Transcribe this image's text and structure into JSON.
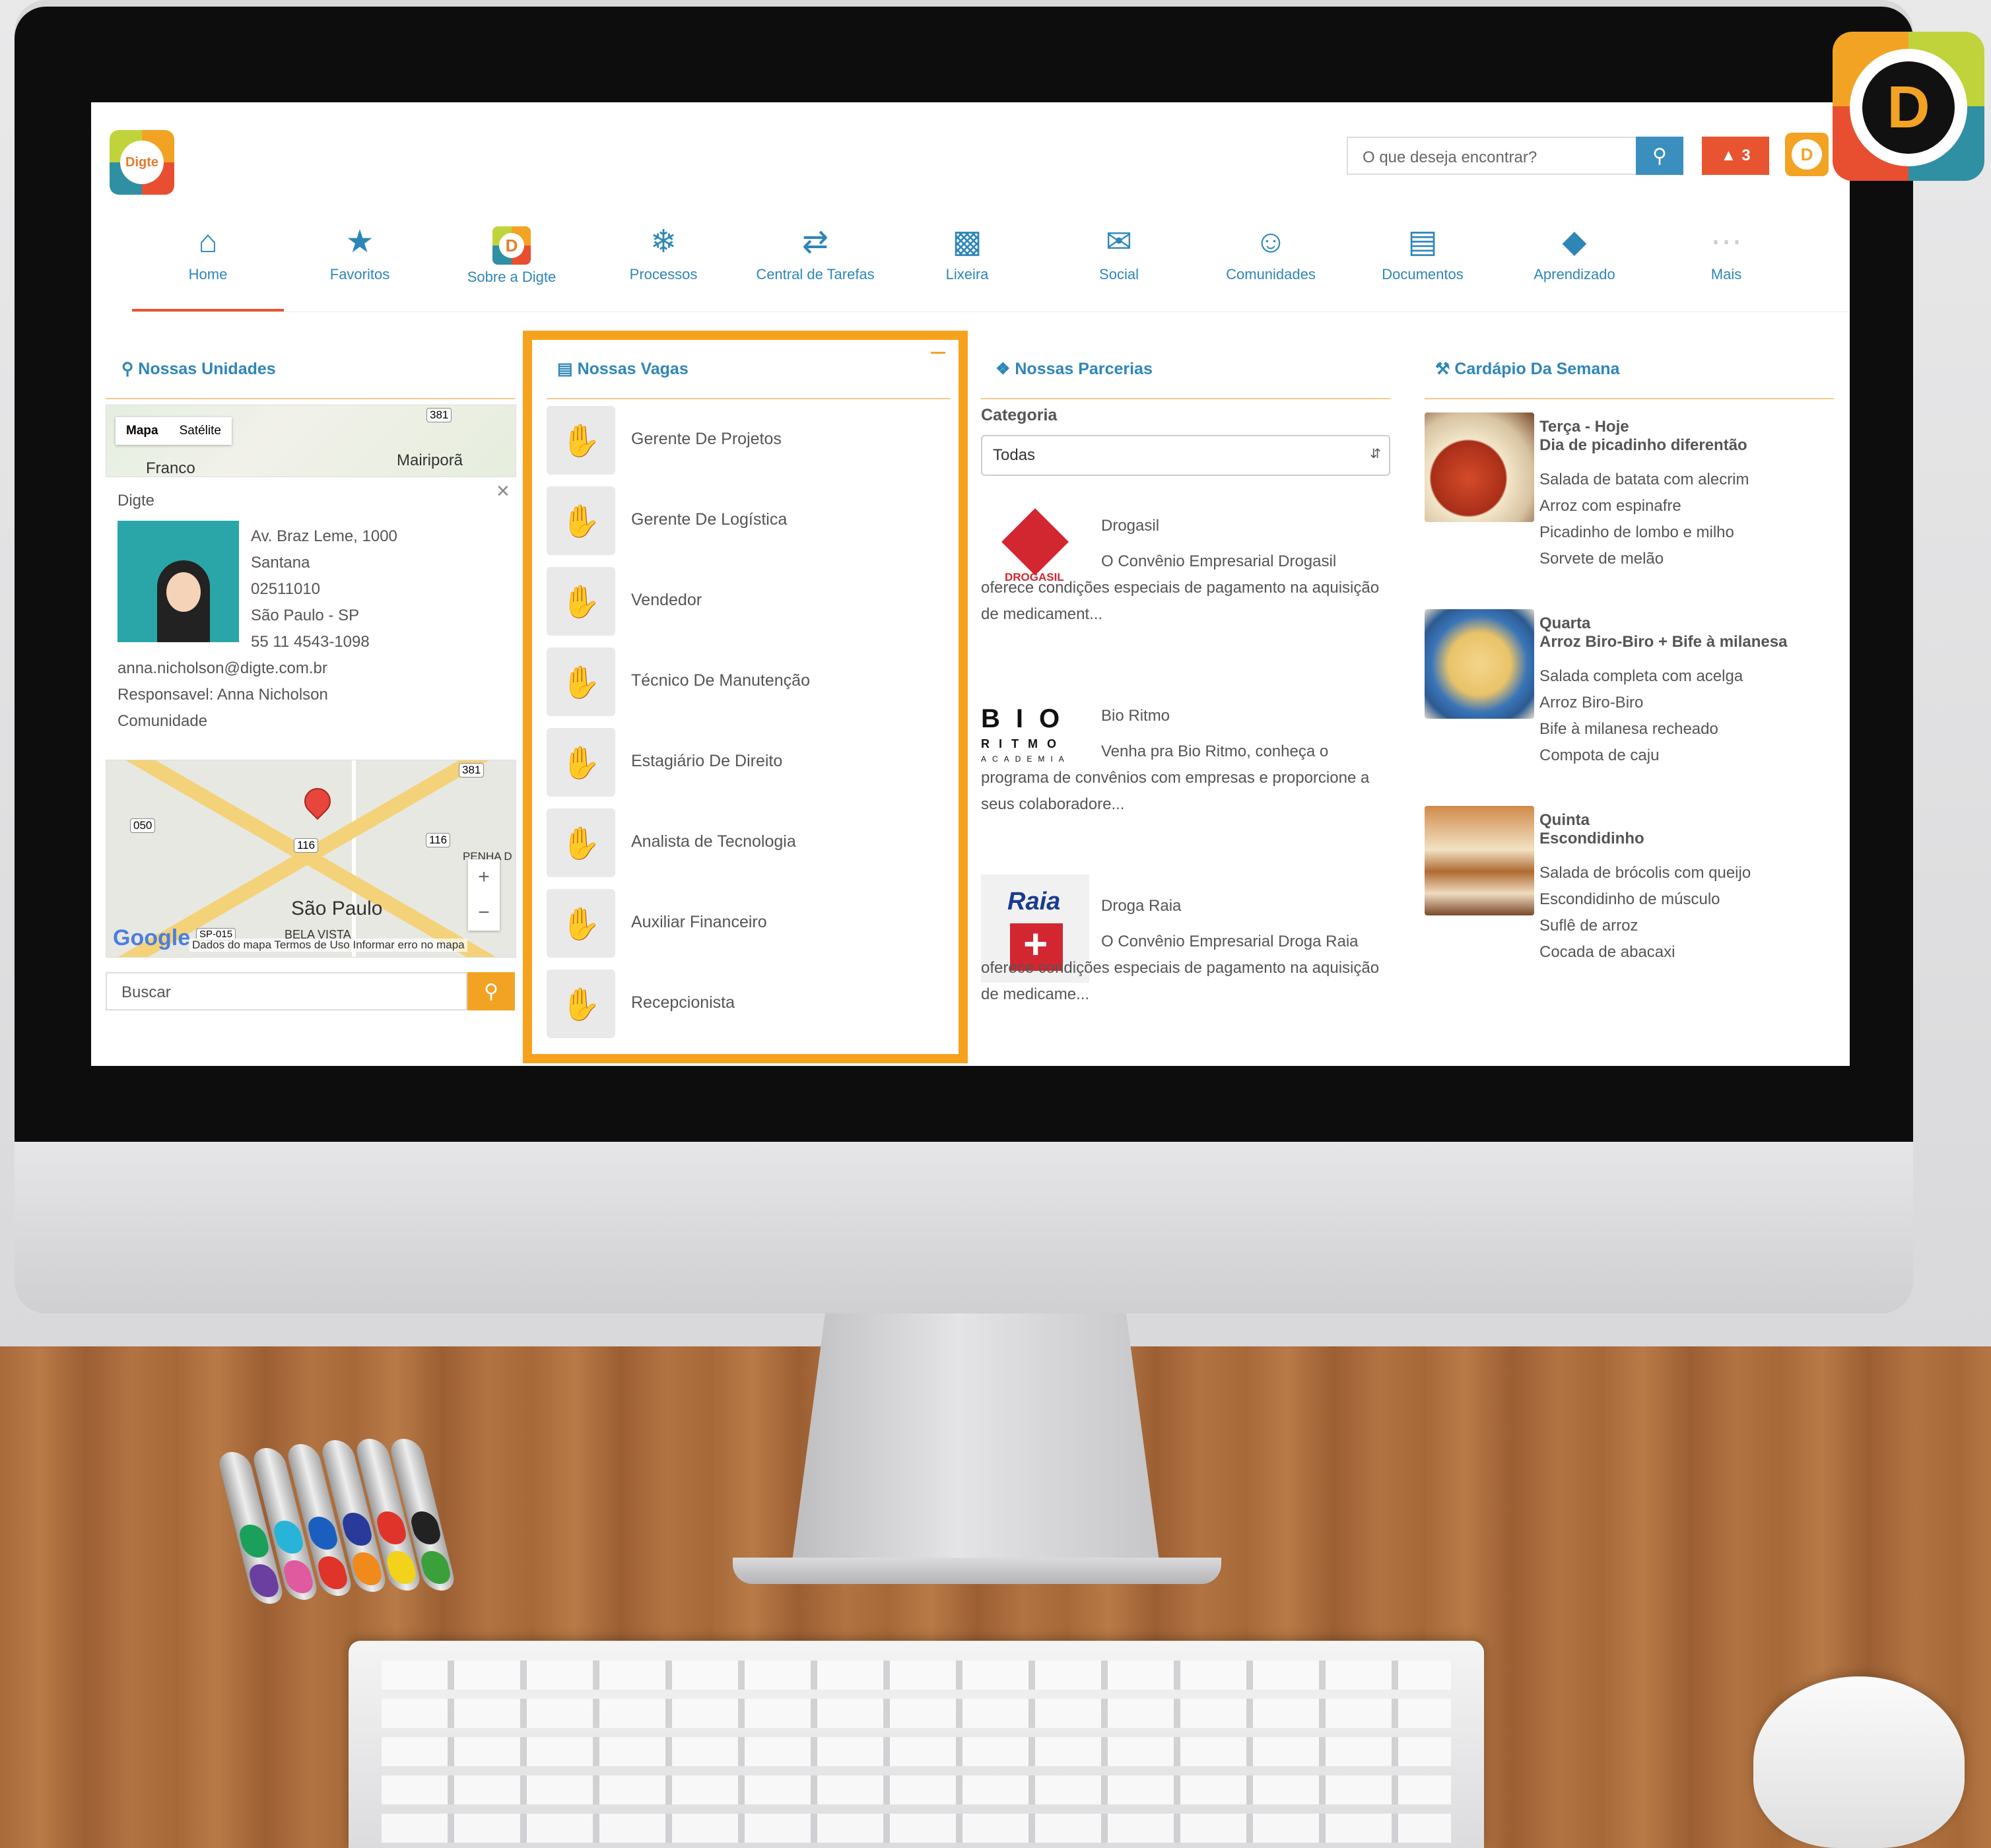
{
  "header": {
    "logo_text": "Digte",
    "search_placeholder": "O que deseja encontrar?",
    "alerts_count": "3",
    "avatar_letter": "D"
  },
  "nav": [
    {
      "label": "Home",
      "icon": "home-icon",
      "active": true
    },
    {
      "label": "Favoritos",
      "icon": "star-icon"
    },
    {
      "label": "Sobre a Digte",
      "icon": "digte-logo-icon"
    },
    {
      "label": "Processos",
      "icon": "processes-icon"
    },
    {
      "label": "Central de Tarefas",
      "icon": "tasks-icon"
    },
    {
      "label": "Lixeira",
      "icon": "trash-icon"
    },
    {
      "label": "Social",
      "icon": "chat-icon"
    },
    {
      "label": "Comunidades",
      "icon": "communities-icon"
    },
    {
      "label": "Documentos",
      "icon": "documents-icon"
    },
    {
      "label": "Aprendizado",
      "icon": "graduation-cap-icon"
    },
    {
      "label": "Mais",
      "icon": "more-icon"
    }
  ],
  "unidades": {
    "title": "Nossas Unidades",
    "map_tab_map": "Mapa",
    "map_tab_sat": "Satélite",
    "map_label_1": "Franco",
    "map_label_2": "Mairiporã",
    "road_381": "381",
    "name": "Digte",
    "address_lines": [
      "Av. Braz Leme, 1000",
      "Santana",
      "02511010",
      "São Paulo - SP",
      "55 11 4543-1098"
    ],
    "email": "anna.nicholson@digte.com.br",
    "responsible": "Responsavel: Anna Nicholson",
    "type": "Comunidade",
    "map_city": "São Paulo",
    "map_google": "Google",
    "map_footer": "Dados do mapa   Termos de Uso   Informar erro no mapa",
    "road_050": "050",
    "road_116": "116",
    "map_label_penha": "PENHA D",
    "map_label_bela": "BELA VISTA",
    "road_sp015": "SP-015",
    "search_placeholder": "Buscar"
  },
  "vagas": {
    "title": "Nossas Vagas",
    "items": [
      "Gerente De Projetos",
      "Gerente De Logística",
      "Vendedor",
      "Técnico De Manutenção",
      "Estagiário De Direito",
      "Analista de Tecnologia",
      "Auxiliar Financeiro",
      "Recepcionista"
    ]
  },
  "parcerias": {
    "title": "Nossas Parcerias",
    "category_label": "Categoria",
    "category_value": "Todas",
    "partners": [
      {
        "name": "Drogasil",
        "logo": "DROGASIL",
        "desc": "O Convênio Empresarial Drogasil oferece condições especiais de pagamento na aquisição de medicament..."
      },
      {
        "name": "Bio Ritmo",
        "logo": "BIO RITMO ACADEMIA",
        "desc": "Venha pra Bio Ritmo, conheça o programa de convênios com empresas e proporcione a seus colaboradore..."
      },
      {
        "name": "Droga Raia",
        "logo": "Raia",
        "desc": "O Convênio Empresarial Droga Raia oferece condições especiais de pagamento na aquisição de medicame..."
      }
    ]
  },
  "cardapio": {
    "title": "Cardápio Da Semana",
    "days": [
      {
        "day": "Terça - Hoje",
        "dish": "Dia de picadinho diferentão",
        "items": [
          "Salada de batata com alecrim",
          "Arroz com espinafre",
          "Picadinho de lombo e milho",
          "Sorvete de melão"
        ]
      },
      {
        "day": "Quarta",
        "dish": "Arroz Biro-Biro + Bife à milanesa",
        "items": [
          "Salada completa com acelga",
          "Arroz Biro-Biro",
          "Bife à milanesa recheado",
          "Compota de caju"
        ]
      },
      {
        "day": "Quinta",
        "dish": "Escondidinho",
        "items": [
          "Salada de brócolis com queijo",
          "Escondidinho de músculo",
          "Suflê de arroz",
          "Cocada de abacaxi"
        ]
      }
    ]
  },
  "corner_logo_letter": "D",
  "colors": {
    "accent_blue": "#2e86b8",
    "accent_orange": "#f2a324",
    "alert_red": "#e8542f",
    "highlight": "#f7a21c"
  }
}
